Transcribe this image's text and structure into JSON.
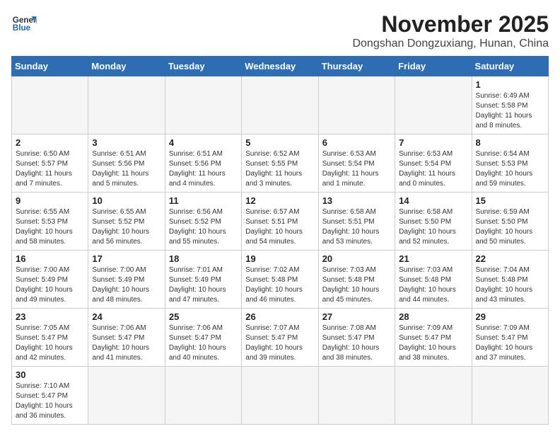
{
  "header": {
    "logo_line1": "General",
    "logo_line2": "Blue",
    "month_title": "November 2025",
    "location": "Dongshan Dongzuxiang, Hunan, China"
  },
  "days_of_week": [
    "Sunday",
    "Monday",
    "Tuesday",
    "Wednesday",
    "Thursday",
    "Friday",
    "Saturday"
  ],
  "weeks": [
    [
      {
        "day": "",
        "info": ""
      },
      {
        "day": "",
        "info": ""
      },
      {
        "day": "",
        "info": ""
      },
      {
        "day": "",
        "info": ""
      },
      {
        "day": "",
        "info": ""
      },
      {
        "day": "",
        "info": ""
      },
      {
        "day": "1",
        "info": "Sunrise: 6:49 AM\nSunset: 5:58 PM\nDaylight: 11 hours and 8 minutes."
      }
    ],
    [
      {
        "day": "2",
        "info": "Sunrise: 6:50 AM\nSunset: 5:57 PM\nDaylight: 11 hours and 7 minutes."
      },
      {
        "day": "3",
        "info": "Sunrise: 6:51 AM\nSunset: 5:56 PM\nDaylight: 11 hours and 5 minutes."
      },
      {
        "day": "4",
        "info": "Sunrise: 6:51 AM\nSunset: 5:56 PM\nDaylight: 11 hours and 4 minutes."
      },
      {
        "day": "5",
        "info": "Sunrise: 6:52 AM\nSunset: 5:55 PM\nDaylight: 11 hours and 3 minutes."
      },
      {
        "day": "6",
        "info": "Sunrise: 6:53 AM\nSunset: 5:54 PM\nDaylight: 11 hours and 1 minute."
      },
      {
        "day": "7",
        "info": "Sunrise: 6:53 AM\nSunset: 5:54 PM\nDaylight: 11 hours and 0 minutes."
      },
      {
        "day": "8",
        "info": "Sunrise: 6:54 AM\nSunset: 5:53 PM\nDaylight: 10 hours and 59 minutes."
      }
    ],
    [
      {
        "day": "9",
        "info": "Sunrise: 6:55 AM\nSunset: 5:53 PM\nDaylight: 10 hours and 58 minutes."
      },
      {
        "day": "10",
        "info": "Sunrise: 6:55 AM\nSunset: 5:52 PM\nDaylight: 10 hours and 56 minutes."
      },
      {
        "day": "11",
        "info": "Sunrise: 6:56 AM\nSunset: 5:52 PM\nDaylight: 10 hours and 55 minutes."
      },
      {
        "day": "12",
        "info": "Sunrise: 6:57 AM\nSunset: 5:51 PM\nDaylight: 10 hours and 54 minutes."
      },
      {
        "day": "13",
        "info": "Sunrise: 6:58 AM\nSunset: 5:51 PM\nDaylight: 10 hours and 53 minutes."
      },
      {
        "day": "14",
        "info": "Sunrise: 6:58 AM\nSunset: 5:50 PM\nDaylight: 10 hours and 52 minutes."
      },
      {
        "day": "15",
        "info": "Sunrise: 6:59 AM\nSunset: 5:50 PM\nDaylight: 10 hours and 50 minutes."
      }
    ],
    [
      {
        "day": "16",
        "info": "Sunrise: 7:00 AM\nSunset: 5:49 PM\nDaylight: 10 hours and 49 minutes."
      },
      {
        "day": "17",
        "info": "Sunrise: 7:00 AM\nSunset: 5:49 PM\nDaylight: 10 hours and 48 minutes."
      },
      {
        "day": "18",
        "info": "Sunrise: 7:01 AM\nSunset: 5:49 PM\nDaylight: 10 hours and 47 minutes."
      },
      {
        "day": "19",
        "info": "Sunrise: 7:02 AM\nSunset: 5:48 PM\nDaylight: 10 hours and 46 minutes."
      },
      {
        "day": "20",
        "info": "Sunrise: 7:03 AM\nSunset: 5:48 PM\nDaylight: 10 hours and 45 minutes."
      },
      {
        "day": "21",
        "info": "Sunrise: 7:03 AM\nSunset: 5:48 PM\nDaylight: 10 hours and 44 minutes."
      },
      {
        "day": "22",
        "info": "Sunrise: 7:04 AM\nSunset: 5:48 PM\nDaylight: 10 hours and 43 minutes."
      }
    ],
    [
      {
        "day": "23",
        "info": "Sunrise: 7:05 AM\nSunset: 5:47 PM\nDaylight: 10 hours and 42 minutes."
      },
      {
        "day": "24",
        "info": "Sunrise: 7:06 AM\nSunset: 5:47 PM\nDaylight: 10 hours and 41 minutes."
      },
      {
        "day": "25",
        "info": "Sunrise: 7:06 AM\nSunset: 5:47 PM\nDaylight: 10 hours and 40 minutes."
      },
      {
        "day": "26",
        "info": "Sunrise: 7:07 AM\nSunset: 5:47 PM\nDaylight: 10 hours and 39 minutes."
      },
      {
        "day": "27",
        "info": "Sunrise: 7:08 AM\nSunset: 5:47 PM\nDaylight: 10 hours and 38 minutes."
      },
      {
        "day": "28",
        "info": "Sunrise: 7:09 AM\nSunset: 5:47 PM\nDaylight: 10 hours and 38 minutes."
      },
      {
        "day": "29",
        "info": "Sunrise: 7:09 AM\nSunset: 5:47 PM\nDaylight: 10 hours and 37 minutes."
      }
    ],
    [
      {
        "day": "30",
        "info": "Sunrise: 7:10 AM\nSunset: 5:47 PM\nDaylight: 10 hours and 36 minutes."
      },
      {
        "day": "",
        "info": ""
      },
      {
        "day": "",
        "info": ""
      },
      {
        "day": "",
        "info": ""
      },
      {
        "day": "",
        "info": ""
      },
      {
        "day": "",
        "info": ""
      },
      {
        "day": "",
        "info": ""
      }
    ]
  ]
}
